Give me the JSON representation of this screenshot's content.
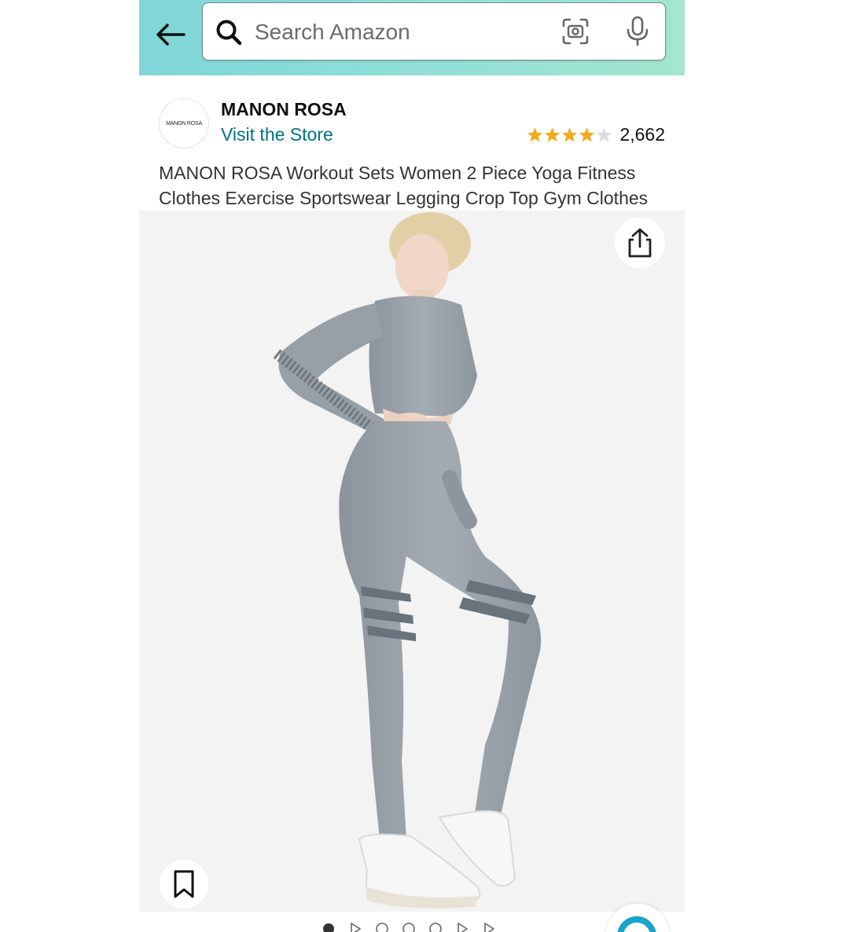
{
  "header": {
    "back_icon": "arrow-left-icon",
    "search_placeholder": "Search Amazon",
    "search_value": "",
    "camera_icon": "camera-scan-icon",
    "mic_icon": "microphone-icon"
  },
  "store": {
    "logo_text": "MANON ROSA",
    "brand": "MANON ROSA",
    "visit_label": "Visit the Store"
  },
  "rating": {
    "stars": 4,
    "max_stars": 5,
    "count": "2,662"
  },
  "product": {
    "title": "MANON ROSA Workout Sets Women 2 Piece Yoga Fitness Clothes Exercise Sportswear Legging Crop Top Gym Clothes",
    "image_subject": "model in grey seamless crop top and leggings",
    "share_icon": "share-icon",
    "save_icon": "bookmark-icon"
  },
  "carousel": {
    "indicators": [
      "active-dot",
      "video",
      "dot",
      "dot",
      "dot",
      "video",
      "video"
    ],
    "active_index": 0
  },
  "colors": {
    "header_gradient_start": "#7fd6d8",
    "header_gradient_end": "#a4e6cf",
    "link": "#007185",
    "star": "#f7a91b",
    "rufus": "#19a4c8"
  }
}
